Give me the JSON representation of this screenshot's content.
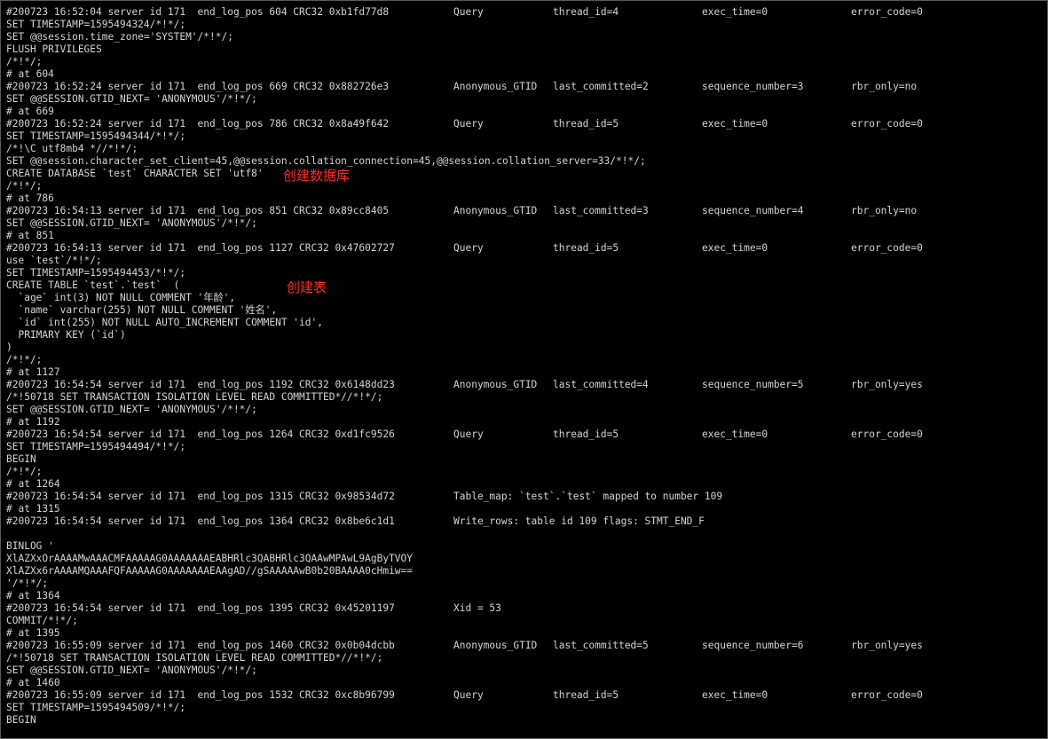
{
  "theme": {
    "foreground": "#d4d4d4",
    "background": "#000000",
    "annotation_color": "#ff2a2a"
  },
  "lines": [
    {
      "text": "#200723 16:52:04 server id 171  end_log_pos 604 CRC32 0xb1fd77d8",
      "c2": "Query",
      "c3": "thread_id=4",
      "c4": "exec_time=0",
      "c5": "error_code=0"
    },
    {
      "text": "SET TIMESTAMP=1595494324/*!*/;"
    },
    {
      "text": "SET @@session.time_zone='SYSTEM'/*!*/;"
    },
    {
      "text": "FLUSH PRIVILEGES"
    },
    {
      "text": "/*!*/;"
    },
    {
      "text": "# at 604"
    },
    {
      "text": "#200723 16:52:24 server id 171  end_log_pos 669 CRC32 0x882726e3",
      "c2": "Anonymous_GTID",
      "c3": "last_committed=2",
      "c4": "sequence_number=3",
      "c5": "rbr_only=no"
    },
    {
      "text": "SET @@SESSION.GTID_NEXT= 'ANONYMOUS'/*!*/;"
    },
    {
      "text": "# at 669"
    },
    {
      "text": "#200723 16:52:24 server id 171  end_log_pos 786 CRC32 0x8a49f642",
      "c2": "Query",
      "c3": "thread_id=5",
      "c4": "exec_time=0",
      "c5": "error_code=0"
    },
    {
      "text": "SET TIMESTAMP=1595494344/*!*/;"
    },
    {
      "text": "/*!\\C utf8mb4 *//*!*/;"
    },
    {
      "text": "SET @@session.character_set_client=45,@@session.collation_connection=45,@@session.collation_server=33/*!*/;"
    },
    {
      "text": "CREATE DATABASE `test` CHARACTER SET 'utf8'"
    },
    {
      "text": "/*!*/;"
    },
    {
      "text": "# at 786"
    },
    {
      "text": "#200723 16:54:13 server id 171  end_log_pos 851 CRC32 0x89cc8405",
      "c2": "Anonymous_GTID",
      "c3": "last_committed=3",
      "c4": "sequence_number=4",
      "c5": "rbr_only=no"
    },
    {
      "text": "SET @@SESSION.GTID_NEXT= 'ANONYMOUS'/*!*/;"
    },
    {
      "text": "# at 851"
    },
    {
      "text": "#200723 16:54:13 server id 171  end_log_pos 1127 CRC32 0x47602727",
      "c2": "Query",
      "c3": "thread_id=5",
      "c4": "exec_time=0",
      "c5": "error_code=0"
    },
    {
      "text": "use `test`/*!*/;"
    },
    {
      "text": "SET TIMESTAMP=1595494453/*!*/;"
    },
    {
      "text": "CREATE TABLE `test`.`test`  ("
    },
    {
      "text": "  `age` int(3) NOT NULL COMMENT '年龄',"
    },
    {
      "text": "  `name` varchar(255) NOT NULL COMMENT '姓名',"
    },
    {
      "text": "  `id` int(255) NOT NULL AUTO_INCREMENT COMMENT 'id',"
    },
    {
      "text": "  PRIMARY KEY (`id`)"
    },
    {
      "text": ")"
    },
    {
      "text": "/*!*/;"
    },
    {
      "text": "# at 1127"
    },
    {
      "text": "#200723 16:54:54 server id 171  end_log_pos 1192 CRC32 0x6148dd23",
      "c2": "Anonymous_GTID",
      "c3": "last_committed=4",
      "c4": "sequence_number=5",
      "c5": "rbr_only=yes"
    },
    {
      "text": "/*!50718 SET TRANSACTION ISOLATION LEVEL READ COMMITTED*//*!*/;"
    },
    {
      "text": "SET @@SESSION.GTID_NEXT= 'ANONYMOUS'/*!*/;"
    },
    {
      "text": "# at 1192"
    },
    {
      "text": "#200723 16:54:54 server id 171  end_log_pos 1264 CRC32 0xd1fc9526",
      "c2": "Query",
      "c3": "thread_id=5",
      "c4": "exec_time=0",
      "c5": "error_code=0"
    },
    {
      "text": "SET TIMESTAMP=1595494494/*!*/;"
    },
    {
      "text": "BEGIN"
    },
    {
      "text": "/*!*/;"
    },
    {
      "text": "# at 1264"
    },
    {
      "text": "#200723 16:54:54 server id 171  end_log_pos 1315 CRC32 0x98534d72",
      "c2": "Table_map: `test`.`test` mapped to number 109"
    },
    {
      "text": "# at 1315"
    },
    {
      "text": "#200723 16:54:54 server id 171  end_log_pos 1364 CRC32 0x8be6c1d1",
      "c2": "Write_rows: table id 109 flags: STMT_END_F"
    },
    {
      "text": ""
    },
    {
      "text": "BINLOG '"
    },
    {
      "text": "XlAZXxOrAAAAMwAAACMFAAAAAG0AAAAAAAEABHRlc3QABHRlc3QAAwMPAwL9AgByTVOY"
    },
    {
      "text": "XlAZXx6rAAAAMQAAAFQFAAAAAG0AAAAAAAEAAgAD//gSAAAAAwB0b20BAAAA0cHmiw=="
    },
    {
      "text": "'/*!*/;"
    },
    {
      "text": "# at 1364"
    },
    {
      "text": "#200723 16:54:54 server id 171  end_log_pos 1395 CRC32 0x45201197",
      "c2": "Xid = 53"
    },
    {
      "text": "COMMIT/*!*/;"
    },
    {
      "text": "# at 1395"
    },
    {
      "text": "#200723 16:55:09 server id 171  end_log_pos 1460 CRC32 0x0b04dcbb",
      "c2": "Anonymous_GTID",
      "c3": "last_committed=5",
      "c4": "sequence_number=6",
      "c5": "rbr_only=yes"
    },
    {
      "text": "/*!50718 SET TRANSACTION ISOLATION LEVEL READ COMMITTED*//*!*/;"
    },
    {
      "text": "SET @@SESSION.GTID_NEXT= 'ANONYMOUS'/*!*/;"
    },
    {
      "text": "# at 1460"
    },
    {
      "text": "#200723 16:55:09 server id 171  end_log_pos 1532 CRC32 0xc8b96799",
      "c2": "Query",
      "c3": "thread_id=5",
      "c4": "exec_time=0",
      "c5": "error_code=0"
    },
    {
      "text": "SET TIMESTAMP=1595494509/*!*/;"
    },
    {
      "text": "BEGIN"
    }
  ],
  "annotations": {
    "create_database": "创建数据库",
    "create_table": "创建表"
  }
}
